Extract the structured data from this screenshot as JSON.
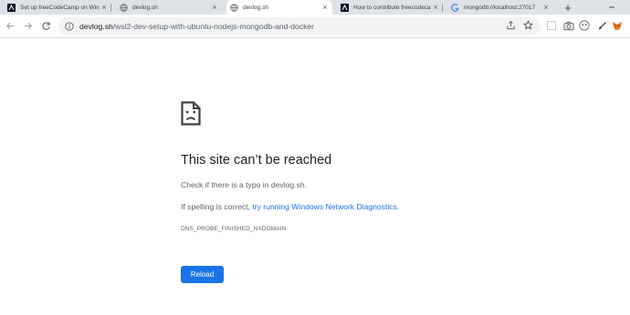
{
  "tabs": [
    {
      "title": "Set up freeCodeCamp on Windows",
      "favicon": "fcc-icon",
      "active": false
    },
    {
      "title": "devlog.sh",
      "favicon": "globe-icon",
      "active": false
    },
    {
      "title": "devlog.sh",
      "favicon": "globe-icon",
      "active": true
    },
    {
      "title": "How to contribute freecodecamp",
      "favicon": "fcc-icon",
      "active": false
    },
    {
      "title": "mongodb://localhost:27017",
      "favicon": "google-icon",
      "active": false
    }
  ],
  "tab_close_glyph": "×",
  "new_tab_glyph": "+",
  "address_bar": {
    "host": "devlog.sh",
    "path": "/wsl2-dev-setup-with-ubuntu-nodejs-mongodb-and-docker"
  },
  "error_page": {
    "title": "This site can’t be reached",
    "line1": "Check if there is a typo in devlog.sh.",
    "line2_prefix": "If spelling is correct, ",
    "line2_link": "try running Windows Network Diagnostics",
    "line2_suffix": ".",
    "error_code": "DNS_PROBE_FINISHED_NXDOMAIN",
    "reload_label": "Reload"
  },
  "colors": {
    "accent": "#1a73e8",
    "tabstrip": "#dee1e6",
    "text": "#202124",
    "secondary_text": "#5f6368"
  }
}
